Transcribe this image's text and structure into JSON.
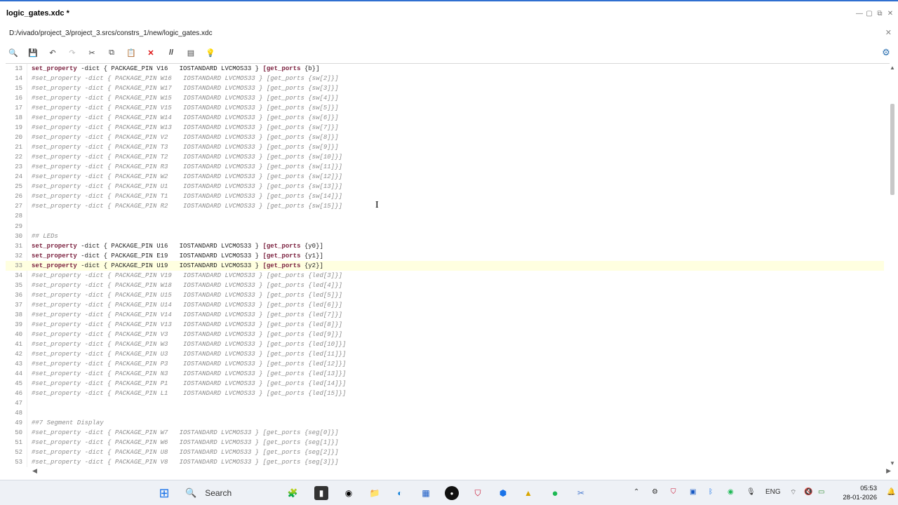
{
  "window": {
    "title": "logic_gates.xdc *",
    "path": "D:/vivado/project_3/project_3.srcs/constrs_1/new/logic_gates.xdc",
    "controls": [
      "—",
      "▢",
      "⧉",
      "✕"
    ]
  },
  "toolbar": {
    "icons": [
      "search-icon",
      "save-icon",
      "undo-icon",
      "redo-icon",
      "cut-icon",
      "copy-icon",
      "paste-icon",
      "delete-icon",
      "comment-icon",
      "column-select-icon",
      "bulb-icon"
    ],
    "glyphs": [
      "🔍",
      "💾",
      "↶",
      "↷",
      "✂",
      "⧉",
      "📋",
      "✕",
      "//",
      "▤",
      "💡"
    ],
    "settings_glyph": "⚙"
  },
  "editor": {
    "current_line": 33,
    "lines": [
      {
        "n": "13",
        "t": "set_property -dict { PACKAGE_PIN V16   IOSTANDARD LVCMOS33 } [get_ports {b}]",
        "c": false
      },
      {
        "n": "14",
        "t": "#set_property -dict { PACKAGE_PIN W16   IOSTANDARD LVCMOS33 } [get_ports {sw[2]}]",
        "c": true
      },
      {
        "n": "15",
        "t": "#set_property -dict { PACKAGE_PIN W17   IOSTANDARD LVCMOS33 } [get_ports {sw[3]}]",
        "c": true
      },
      {
        "n": "16",
        "t": "#set_property -dict { PACKAGE_PIN W15   IOSTANDARD LVCMOS33 } [get_ports {sw[4]}]",
        "c": true
      },
      {
        "n": "17",
        "t": "#set_property -dict { PACKAGE_PIN V15   IOSTANDARD LVCMOS33 } [get_ports {sw[5]}]",
        "c": true
      },
      {
        "n": "18",
        "t": "#set_property -dict { PACKAGE_PIN W14   IOSTANDARD LVCMOS33 } [get_ports {sw[6]}]",
        "c": true
      },
      {
        "n": "19",
        "t": "#set_property -dict { PACKAGE_PIN W13   IOSTANDARD LVCMOS33 } [get_ports {sw[7]}]",
        "c": true
      },
      {
        "n": "20",
        "t": "#set_property -dict { PACKAGE_PIN V2    IOSTANDARD LVCMOS33 } [get_ports {sw[8]}]",
        "c": true
      },
      {
        "n": "21",
        "t": "#set_property -dict { PACKAGE_PIN T3    IOSTANDARD LVCMOS33 } [get_ports {sw[9]}]",
        "c": true
      },
      {
        "n": "22",
        "t": "#set_property -dict { PACKAGE_PIN T2    IOSTANDARD LVCMOS33 } [get_ports {sw[10]}]",
        "c": true
      },
      {
        "n": "23",
        "t": "#set_property -dict { PACKAGE_PIN R3    IOSTANDARD LVCMOS33 } [get_ports {sw[11]}]",
        "c": true
      },
      {
        "n": "24",
        "t": "#set_property -dict { PACKAGE_PIN W2    IOSTANDARD LVCMOS33 } [get_ports {sw[12]}]",
        "c": true
      },
      {
        "n": "25",
        "t": "#set_property -dict { PACKAGE_PIN U1    IOSTANDARD LVCMOS33 } [get_ports {sw[13]}]",
        "c": true
      },
      {
        "n": "26",
        "t": "#set_property -dict { PACKAGE_PIN T1    IOSTANDARD LVCMOS33 } [get_ports {sw[14]}]",
        "c": true
      },
      {
        "n": "27",
        "t": "#set_property -dict { PACKAGE_PIN R2    IOSTANDARD LVCMOS33 } [get_ports {sw[15]}]",
        "c": true
      },
      {
        "n": "28",
        "t": "",
        "c": false
      },
      {
        "n": "29",
        "t": "",
        "c": false
      },
      {
        "n": "30",
        "t": "## LEDs",
        "c": true
      },
      {
        "n": "31",
        "t": "set_property -dict { PACKAGE_PIN U16   IOSTANDARD LVCMOS33 } [get_ports {y0}]",
        "c": false
      },
      {
        "n": "32",
        "t": "set_property -dict { PACKAGE_PIN E19   IOSTANDARD LVCMOS33 } [get_ports {y1}]",
        "c": false
      },
      {
        "n": "33",
        "t": "set_property -dict { PACKAGE_PIN U19   IOSTANDARD LVCMOS33 } [get_ports {y2}]",
        "c": false
      },
      {
        "n": "34",
        "t": "#set_property -dict { PACKAGE_PIN V19   IOSTANDARD LVCMOS33 } [get_ports {led[3]}]",
        "c": true
      },
      {
        "n": "35",
        "t": "#set_property -dict { PACKAGE_PIN W18   IOSTANDARD LVCMOS33 } [get_ports {led[4]}]",
        "c": true
      },
      {
        "n": "36",
        "t": "#set_property -dict { PACKAGE_PIN U15   IOSTANDARD LVCMOS33 } [get_ports {led[5]}]",
        "c": true
      },
      {
        "n": "37",
        "t": "#set_property -dict { PACKAGE_PIN U14   IOSTANDARD LVCMOS33 } [get_ports {led[6]}]",
        "c": true
      },
      {
        "n": "38",
        "t": "#set_property -dict { PACKAGE_PIN V14   IOSTANDARD LVCMOS33 } [get_ports {led[7]}]",
        "c": true
      },
      {
        "n": "39",
        "t": "#set_property -dict { PACKAGE_PIN V13   IOSTANDARD LVCMOS33 } [get_ports {led[8]}]",
        "c": true
      },
      {
        "n": "40",
        "t": "#set_property -dict { PACKAGE_PIN V3    IOSTANDARD LVCMOS33 } [get_ports {led[9]}]",
        "c": true
      },
      {
        "n": "41",
        "t": "#set_property -dict { PACKAGE_PIN W3    IOSTANDARD LVCMOS33 } [get_ports {led[10]}]",
        "c": true
      },
      {
        "n": "42",
        "t": "#set_property -dict { PACKAGE_PIN U3    IOSTANDARD LVCMOS33 } [get_ports {led[11]}]",
        "c": true
      },
      {
        "n": "43",
        "t": "#set_property -dict { PACKAGE_PIN P3    IOSTANDARD LVCMOS33 } [get_ports {led[12]}]",
        "c": true
      },
      {
        "n": "44",
        "t": "#set_property -dict { PACKAGE_PIN N3    IOSTANDARD LVCMOS33 } [get_ports {led[13]}]",
        "c": true
      },
      {
        "n": "45",
        "t": "#set_property -dict { PACKAGE_PIN P1    IOSTANDARD LVCMOS33 } [get_ports {led[14]}]",
        "c": true
      },
      {
        "n": "46",
        "t": "#set_property -dict { PACKAGE_PIN L1    IOSTANDARD LVCMOS33 } [get_ports {led[15]}]",
        "c": true
      },
      {
        "n": "47",
        "t": "",
        "c": false
      },
      {
        "n": "48",
        "t": "",
        "c": false
      },
      {
        "n": "49",
        "t": "##7 Segment Display",
        "c": true
      },
      {
        "n": "50",
        "t": "#set_property -dict { PACKAGE_PIN W7   IOSTANDARD LVCMOS33 } [get_ports {seg[0]}]",
        "c": true
      },
      {
        "n": "51",
        "t": "#set_property -dict { PACKAGE_PIN W6   IOSTANDARD LVCMOS33 } [get_ports {seg[1]}]",
        "c": true
      },
      {
        "n": "52",
        "t": "#set_property -dict { PACKAGE_PIN U8   IOSTANDARD LVCMOS33 } [get_ports {seg[2]}]",
        "c": true
      },
      {
        "n": "53",
        "t": "#set_property -dict { PACKAGE_PIN V8   IOSTANDARD LVCMOS33 } [get_ports {seg[3]}]",
        "c": true
      }
    ]
  },
  "taskbar": {
    "search_label": "Search",
    "tray_lang": "ENG",
    "time": "05:53",
    "date": "28-01-2026"
  }
}
